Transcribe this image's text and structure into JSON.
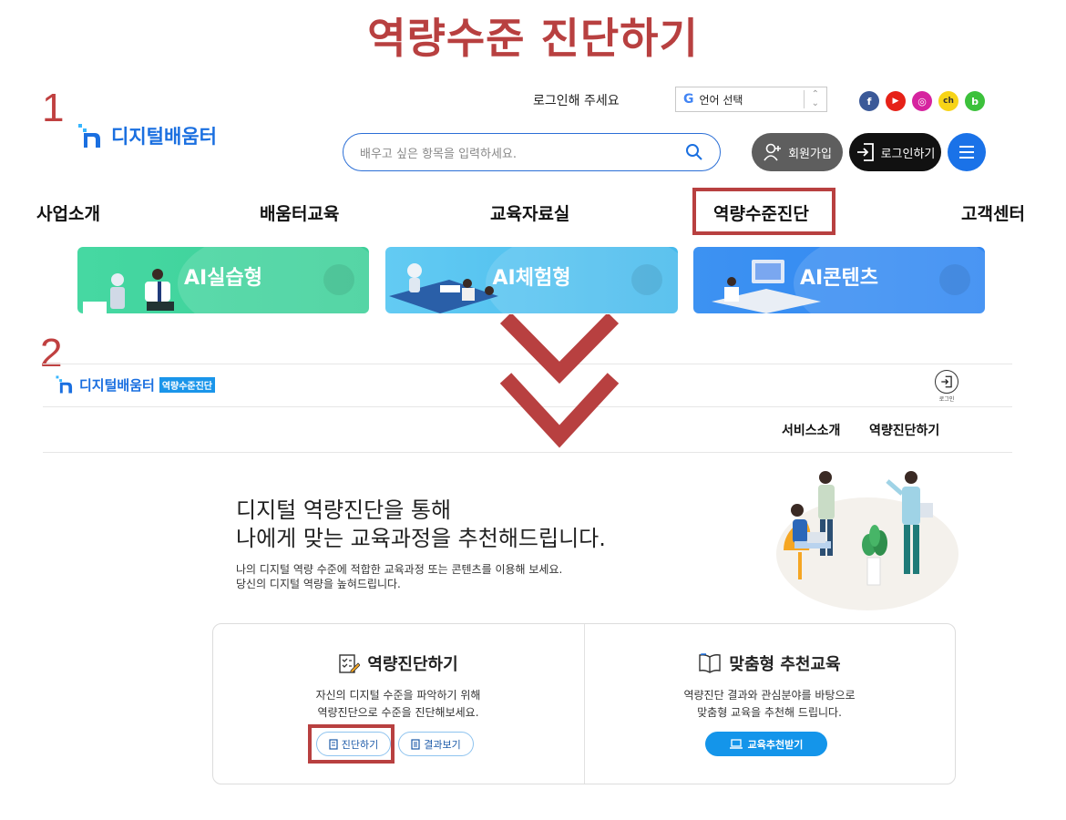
{
  "page_title": "역량수준 진단하기",
  "steps": {
    "one": "1",
    "two": "2"
  },
  "header": {
    "brand": "디지털배움터",
    "login_prompt": "로그인해 주세요",
    "language_label": "언어 선택",
    "language_logo": "G",
    "social": [
      {
        "name": "facebook",
        "glyph": "f",
        "color": "#3b5998"
      },
      {
        "name": "youtube",
        "glyph": "▶",
        "color": "#e62117"
      },
      {
        "name": "instagram",
        "glyph": "◎",
        "color": "#d6249f"
      },
      {
        "name": "kakao-channel",
        "glyph": "ch",
        "color": "#f7d417"
      },
      {
        "name": "naver-band",
        "glyph": "b",
        "color": "#3cc13b"
      }
    ],
    "search_placeholder": "배우고 싶은 항목을 입력하세요.",
    "signup_label": "회원가입",
    "login_label": "로그인하기"
  },
  "nav": {
    "items": [
      "사업소개",
      "배움터교육",
      "교육자료실",
      "역량수준진단",
      "고객센터"
    ],
    "highlighted_item": "역량수준진단"
  },
  "cards": [
    {
      "label": "AI실습형",
      "color": "#3ed39d"
    },
    {
      "label": "AI체험형",
      "color": "#4fc0ee"
    },
    {
      "label": "AI콘텐츠",
      "color": "#2f86f2"
    }
  ],
  "diagnosis_page": {
    "brand": "디지털배움터",
    "brand_badge": "역량수준진단",
    "login_label": "로그인",
    "subnav": [
      "서비스소개",
      "역량진단하기"
    ],
    "hero_title_line1": "디지털 역량진단을 통해",
    "hero_title_line2": "나에게 맞는 교육과정을 추천해드립니다.",
    "hero_desc_line1": "나의 디지털 역량 수준에 적합한 교육과정 또는 콘텐츠를 이용해 보세요.",
    "hero_desc_line2": "당신의 디지털 역량을 높혀드립니다.",
    "panel_left": {
      "title": "역량진단하기",
      "desc_line1": "자신의 디지털 수준을 파악하기 위해",
      "desc_line2": "역량진단으로 수준을 진단해보세요.",
      "button_primary": "진단하기",
      "button_secondary": "결과보기"
    },
    "panel_right": {
      "title": "맞춤형 추천교육",
      "desc_line1": "역량진단 결과와 관심분야를 바탕으로",
      "desc_line2": "맞춤형 교육을 추천해 드립니다.",
      "button": "교육추천받기"
    }
  },
  "colors": {
    "accent_red": "#b84040",
    "brand_blue": "#1a6fe0",
    "button_blue": "#1495ea"
  }
}
